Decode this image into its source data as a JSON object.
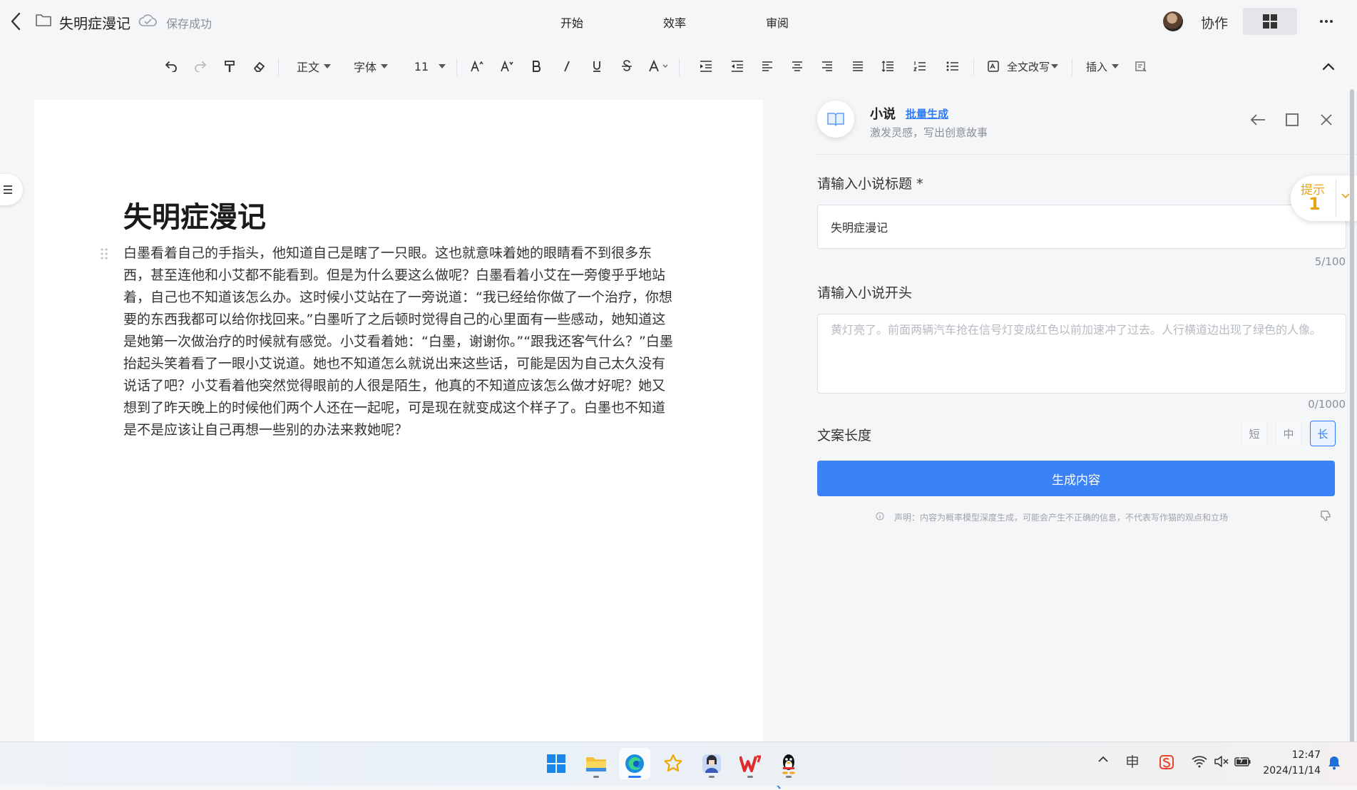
{
  "titlebar": {
    "doc_name": "失明症漫记",
    "save_status": "保存成功",
    "menu": [
      "开始",
      "效率",
      "审阅"
    ],
    "collab_label": "协作"
  },
  "toolbar": {
    "style_label": "正文",
    "font_label": "字体",
    "size_label": "11",
    "rewrite_label": "全文改写",
    "insert_label": "插入",
    "icons": [
      "undo-icon",
      "redo-icon",
      "format-painter-icon",
      "eraser-icon",
      "increase-font-icon",
      "decrease-font-icon",
      "bold-icon",
      "italic-icon",
      "underline-icon",
      "strikethrough-icon",
      "font-color-icon",
      "indent-increase-icon",
      "indent-decrease-icon",
      "align-left-icon",
      "align-center-icon",
      "align-right-icon",
      "justify-icon",
      "line-spacing-icon",
      "ordered-list-icon",
      "bullet-list-icon",
      "ai-rewrite-icon",
      "preview-icon",
      "collapse-up-icon"
    ]
  },
  "document": {
    "title": "失明症漫记",
    "paragraph": "白墨看着自己的手指头，他知道自己是瞎了一只眼。这也就意味着她的眼睛看不到很多东西，甚至连他和小艾都不能看到。但是为什么要这么做呢？白墨看着小艾在一旁傻乎乎地站着，自己也不知道该怎么办。这时候小艾站在了一旁说道：“我已经给你做了一个治疗，你想要的东西我都可以给你找回来。”白墨听了之后顿时觉得自己的心里面有一些感动，她知道这是她第一次做治疗的时候就有感觉。小艾看着她：“白墨，谢谢你。”“跟我还客气什么？”白墨抬起头笑着看了一眼小艾说道。她也不知道怎么就说出来这些话，可能是因为自己太久没有说话了吧？小艾看着他突然觉得眼前的人很是陌生，他真的不知道应该怎么做才好呢？她又想到了昨天晚上的时候他们两个人还在一起呢，可是现在就变成这个样子了。白墨也不知道是不是应该让自己再想一些别的办法来救她呢？"
  },
  "panel": {
    "title": "小说",
    "batch_link": "批量生成",
    "subtitle": "激发灵感，写出创意故事",
    "title_field": {
      "label": "请输入小说标题",
      "required_mark": "*",
      "value": "失明症漫记",
      "count": "5/100"
    },
    "opening_field": {
      "label": "请输入小说开头",
      "value": "",
      "placeholder": "黄灯亮了。前面两辆汽车抢在信号灯变成红色以前加速冲了过去。人行横道边出现了绿色的人像。",
      "count": "0/1000"
    },
    "length": {
      "label": "文案长度",
      "options": [
        "短",
        "中",
        "长"
      ],
      "selected": "长"
    },
    "generate_button": "生成内容",
    "disclaimer": "声明：内容为概率模型深度生成，可能会产生不正确的信息，不代表写作猫的观点和立场"
  },
  "hint": {
    "label": "提示",
    "count": "1",
    "color": "#e8a317"
  },
  "taskbar": {
    "apps": [
      "windows-start",
      "file-explorer",
      "edge-browser",
      "favorites-star",
      "avatar-app",
      "wps-office",
      "qq"
    ],
    "time": "12:47",
    "date": "2024/11/14"
  },
  "colors": {
    "accent": "#3b82f6",
    "link": "#2b7cf6",
    "hint": "#e8a317"
  }
}
